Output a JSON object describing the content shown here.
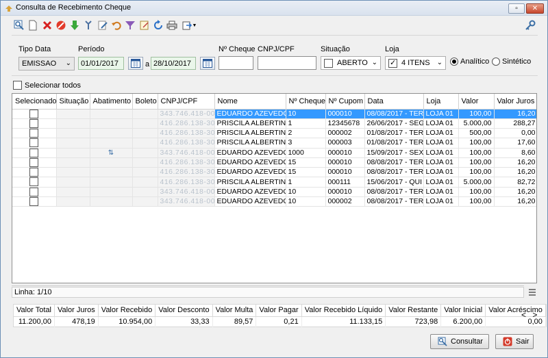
{
  "window": {
    "title": "Consulta de Recebimento Cheque",
    "min_label": "▫",
    "close_label": "✕"
  },
  "filters": {
    "tipo_data_label": "Tipo Data",
    "tipo_data_value": "EMISSAO",
    "periodo_label": "Período",
    "date_from": "01/01/2017",
    "date_sep": "a",
    "date_to": "28/10/2017",
    "cheque_label": "Nº Cheque",
    "cnpj_label": "CNPJ/CPF",
    "situacao_label": "Situação",
    "situacao_value": "ABERTO",
    "loja_label": "Loja",
    "loja_value": "4 ITENS",
    "analitico_label": "Analítico",
    "sintetico_label": "Sintético"
  },
  "select_all_label": "Selecionar todos",
  "grid": {
    "columns": [
      "Selecionado",
      "Situação",
      "Abatimento",
      "Boleto",
      "CNPJ/CPF",
      "Nome",
      "Nº Cheque",
      "Nº Cupom",
      "Data",
      "Loja",
      "Valor",
      "Valor Juros"
    ],
    "rows": [
      {
        "cnpj": "343.746.418-00",
        "nome": "EDUARDO AZEVEDO",
        "cheque": "10",
        "cupom": "000010",
        "data": "08/08/2017 - TER",
        "loja": "LOJA 01",
        "valor": "100,00",
        "juros": "16,20"
      },
      {
        "cnpj": "416.286.138-30",
        "nome": "PRISCILA ALBERTINI",
        "cheque": "1",
        "cupom": "12345678",
        "data": "26/06/2017 - SEG",
        "loja": "LOJA 01",
        "valor": "5.000,00",
        "juros": "288,27"
      },
      {
        "cnpj": "416.286.138-30",
        "nome": "PRISCILA ALBERTINI",
        "cheque": "2",
        "cupom": "000002",
        "data": "01/08/2017 - TER",
        "loja": "LOJA 01",
        "valor": "500,00",
        "juros": "0,00"
      },
      {
        "cnpj": "416.286.138-30",
        "nome": "PRISCILA ALBERTINI",
        "cheque": "3",
        "cupom": "000003",
        "data": "01/08/2017 - TER",
        "loja": "LOJA 01",
        "valor": "100,00",
        "juros": "17,60"
      },
      {
        "cnpj": "343.746.418-00",
        "nome": "EDUARDO AZEVEDO",
        "cheque": "1000",
        "cupom": "000010",
        "data": "15/09/2017 - SEX",
        "loja": "LOJA 01",
        "valor": "100,00",
        "juros": "8,60"
      },
      {
        "cnpj": "416.286.138-30",
        "nome": "EDUARDO AZEVEDO",
        "cheque": "15",
        "cupom": "000010",
        "data": "08/08/2017 - TER",
        "loja": "LOJA 01",
        "valor": "100,00",
        "juros": "16,20"
      },
      {
        "cnpj": "416.286.138-30",
        "nome": "EDUARDO AZEVEDO",
        "cheque": "15",
        "cupom": "000010",
        "data": "08/08/2017 - TER",
        "loja": "LOJA 01",
        "valor": "100,00",
        "juros": "16,20"
      },
      {
        "cnpj": "416.286.138-30",
        "nome": "PRISCILA ALBERTINI",
        "cheque": "1",
        "cupom": "000111",
        "data": "15/06/2017 - QUI",
        "loja": "LOJA 01",
        "valor": "5.000,00",
        "juros": "82,72"
      },
      {
        "cnpj": "343.746.418-00",
        "nome": "EDUARDO AZEVEDO",
        "cheque": "10",
        "cupom": "000010",
        "data": "08/08/2017 - TER",
        "loja": "LOJA 01",
        "valor": "100,00",
        "juros": "16,20"
      },
      {
        "cnpj": "343.746.418-00",
        "nome": "EDUARDO AZEVEDO",
        "cheque": "10",
        "cupom": "000002",
        "data": "08/08/2017 - TER",
        "loja": "LOJA 01",
        "valor": "100,00",
        "juros": "16,20"
      }
    ]
  },
  "status": {
    "linha": "Linha: 1/10"
  },
  "totals": {
    "headers": [
      "Valor Total",
      "Valor Juros",
      "Valor Recebido",
      "Valor Desconto",
      "Valor Multa",
      "Valor Pagar",
      "Valor Recebido Líquido",
      "Valor Restante",
      "Valor Inicial",
      "Valor Acréscimo"
    ],
    "values": [
      "11.200,00",
      "478,19",
      "10.954,00",
      "33,33",
      "89,57",
      "0,21",
      "11.133,15",
      "723,98",
      "6.200,00",
      "0,00"
    ]
  },
  "nav": {
    "prev": "<",
    "next": ">"
  },
  "buttons": {
    "consultar": "Consultar",
    "sair": "Sair"
  },
  "colors": {
    "selection": "#3399ff",
    "accent_close": "#c7452b"
  }
}
